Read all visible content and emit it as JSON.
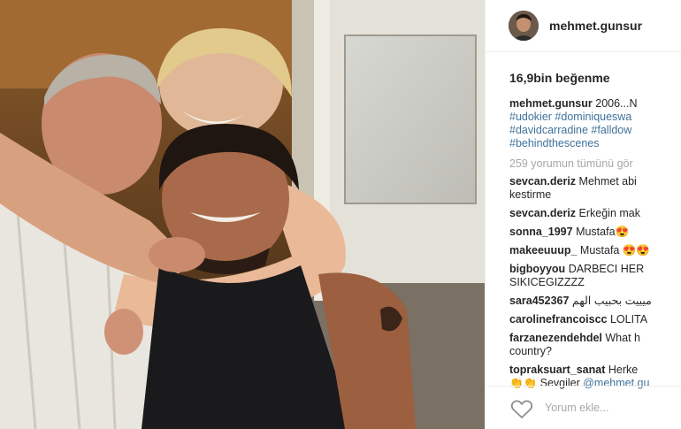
{
  "post": {
    "username": "mehmet.gunsur",
    "likes_text": "16,9bin beğenme",
    "caption_text": "2006...N",
    "hashtags": [
      "#udokier #dominiqueswa",
      "#davidcarradine #falldow",
      "#behindthescenes"
    ],
    "view_all_comments": "259 yorumun tümünü gör",
    "add_comment_placeholder": "Yorum ekle..."
  },
  "comments": [
    {
      "user": "sevcan.deriz",
      "text": "Mehmet abi",
      "text2": "kestirme"
    },
    {
      "user": "sevcan.deriz",
      "text": "Erkeğin mak"
    },
    {
      "user": "sonna_1997",
      "text": "Mustafa😍"
    },
    {
      "user": "makeeuuup_",
      "text": "Mustafa 😍😍"
    },
    {
      "user": "bigboyyou",
      "text": "DARBECI HER",
      "text2": "SIKICEGIZZZZ"
    },
    {
      "user": "sara452367",
      "text": "ميييت بحبيب الهم"
    },
    {
      "user": "carolinefrancoiscc",
      "text": "LOLITA"
    },
    {
      "user": "farzanezendehdel",
      "text": "What h",
      "text2": "country?"
    },
    {
      "user": "topraksuart_sanat",
      "text": "Herke",
      "text2": "👏👏 Sevgiler ",
      "mention": "@mehmet.gu"
    }
  ],
  "colors": {
    "link": "#3f729b",
    "muted": "#a5a7aa",
    "border": "#efefef"
  },
  "icons": {
    "heart": "heart-outline-icon",
    "avatar": "avatar"
  }
}
